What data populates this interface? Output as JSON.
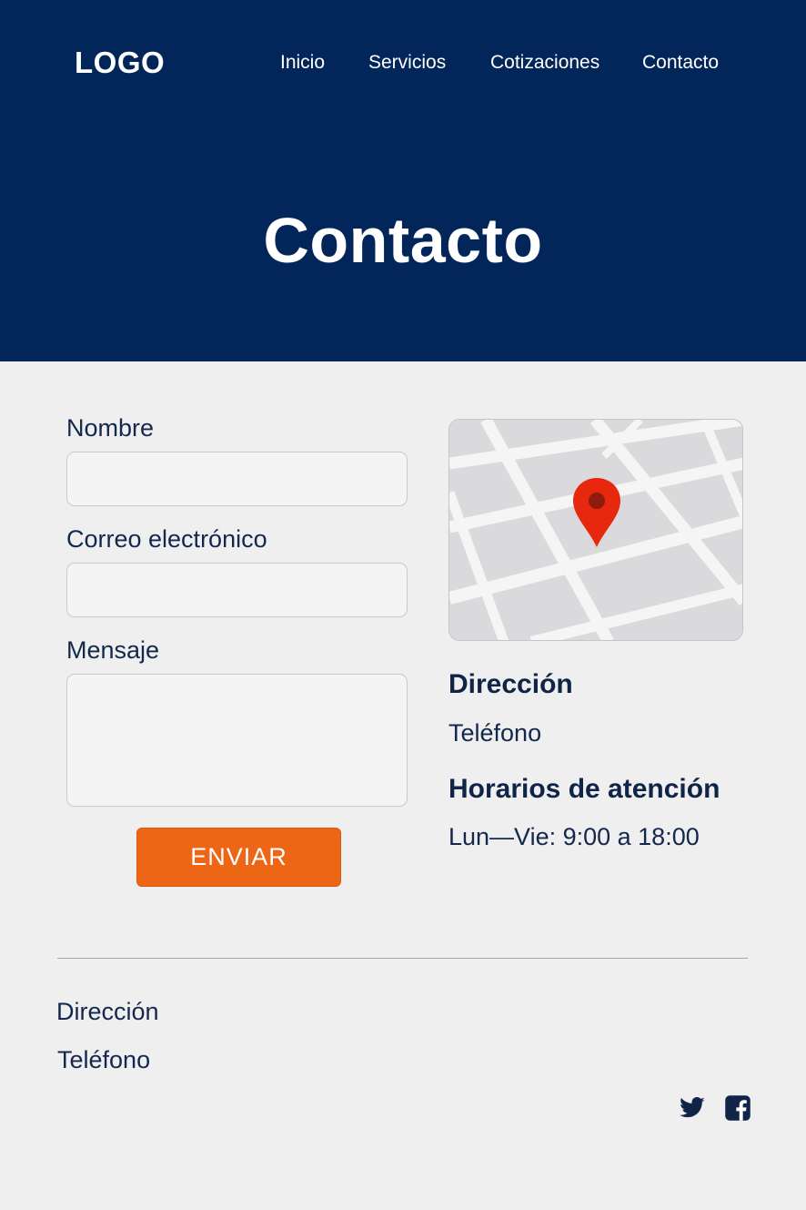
{
  "header": {
    "logo": "LOGO",
    "nav": [
      "Inicio",
      "Servicios",
      "Cotizaciones",
      "Contacto"
    ]
  },
  "hero": {
    "title": "Contacto"
  },
  "form": {
    "name_label": "Nombre",
    "name_value": "",
    "email_label": "Correo electrónico",
    "email_value": "",
    "message_label": "Mensaje",
    "message_value": "",
    "submit_label": "ENVIAR"
  },
  "map": {
    "pin_icon": "location-pin-icon",
    "pin_color": "#e8270f"
  },
  "info": {
    "address_heading": "Dirección",
    "phone": "Teléfono",
    "hours_heading": "Horarios de atención",
    "hours": "Lun—Vie: 9:00 a 18:00"
  },
  "footer": {
    "address": "Dirección",
    "phone": "Teléfono",
    "social": [
      "twitter-icon",
      "facebook-icon"
    ]
  },
  "colors": {
    "navy": "#03265a",
    "accent": "#ec6615",
    "text": "#13284c",
    "background": "#efeff0"
  }
}
